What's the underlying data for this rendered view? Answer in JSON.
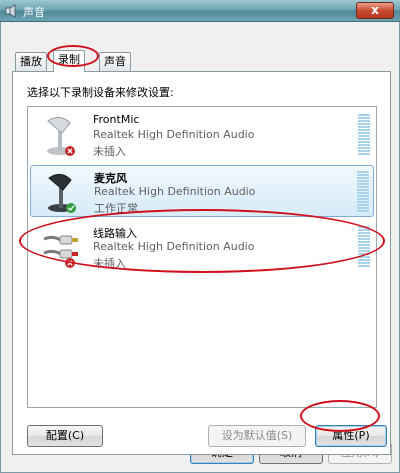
{
  "window": {
    "title": "声音",
    "close_label": "x"
  },
  "tabs": [
    {
      "label": "播放",
      "active": false
    },
    {
      "label": "录制",
      "active": true
    },
    {
      "label": "声音",
      "active": false
    }
  ],
  "instruction": "选择以下录制设备来修改设置:",
  "devices": [
    {
      "name": "FrontMic",
      "driver": "Realtek High Definition Audio",
      "status": "未插入",
      "icon": "microphone-icon",
      "badge": "unplugged-badge-icon",
      "selected": false
    },
    {
      "name": "麦克风",
      "driver": "Realtek High Definition Audio",
      "status": "工作正常",
      "icon": "microphone-icon",
      "badge": "check-badge-icon",
      "selected": true
    },
    {
      "name": "线路输入",
      "driver": "Realtek High Definition Audio",
      "status": "未插入",
      "icon": "rca-cable-icon",
      "badge": "unplugged-badge-icon",
      "selected": false
    }
  ],
  "buttons": {
    "configure": "配置(C)",
    "set_default": "设为默认值(S)",
    "properties": "属性(P)",
    "ok": "确定",
    "cancel": "取消",
    "apply": "应用(A)"
  },
  "colors": {
    "highlight": "#d0101a",
    "selection": "#d6ebf9",
    "level_meter": "#a8d3ea"
  }
}
